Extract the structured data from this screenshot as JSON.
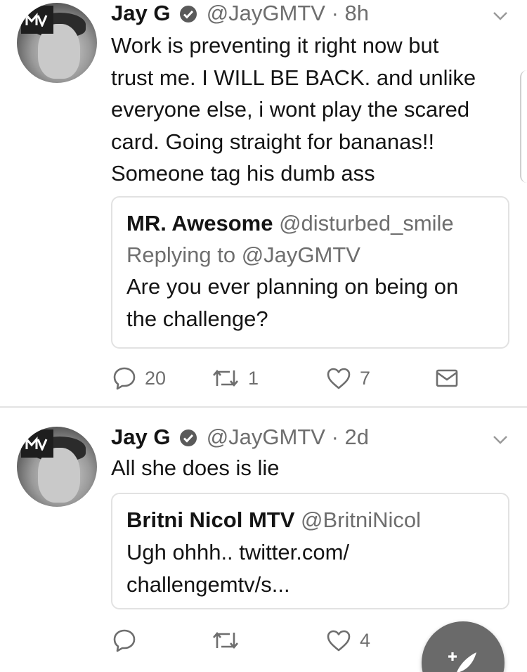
{
  "tweets": [
    {
      "author_name": "Jay G",
      "handle": "@JayGMTV",
      "separator": "·",
      "time": "8h",
      "text_lines": [
        "Work is preventing it right now but",
        "trust me. I WILL BE BACK. and unlike",
        "everyone else, i wont play the scared",
        "card. Going straight for bananas!!",
        "Someone tag his dumb ass"
      ],
      "quote": {
        "author_name": "MR. Awesome",
        "handle": "@disturbed_smile",
        "replying_to": "Replying to @JayGMTV",
        "text_lines": [
          "Are you ever planning on being on",
          "the challenge?"
        ]
      },
      "actions": {
        "replies": "20",
        "retweets": "1",
        "likes": "7"
      }
    },
    {
      "author_name": "Jay G",
      "handle": "@JayGMTV",
      "separator": "·",
      "time": "2d",
      "text_lines": [
        "All she does is lie"
      ],
      "quote": {
        "author_name": "Britni Nicol MTV",
        "handle": "@BritniNicol",
        "text_lines": [
          "Ugh ohhh.. twitter.com/",
          "challengemtv/s..."
        ]
      },
      "actions": {
        "replies": "",
        "retweets": "",
        "likes": "4"
      }
    }
  ],
  "icons": {
    "verified": "verified-badge-icon",
    "chevron": "chevron-down-icon",
    "reply": "reply-icon",
    "retweet": "retweet-icon",
    "like": "heart-icon",
    "dm": "mail-icon",
    "compose": "compose-tweet-icon"
  },
  "colors": {
    "text": "#141414",
    "muted": "#6e6e6e",
    "border": "#e2e2e2",
    "fab": "#6a6a6a"
  }
}
